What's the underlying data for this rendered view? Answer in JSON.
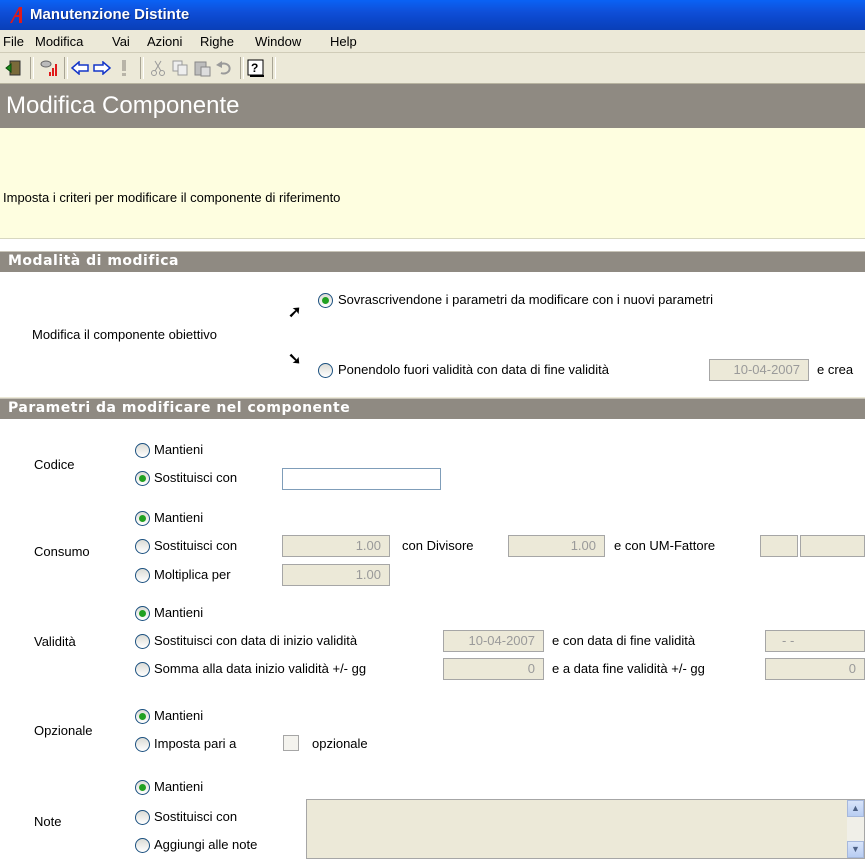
{
  "window": {
    "title": "Manutenzione Distinte"
  },
  "menu": [
    "File",
    "Modifica",
    "Vai",
    "Azioni",
    "Righe",
    "Window",
    "Help"
  ],
  "page": {
    "title": "Modifica Componente",
    "description": "Imposta i criteri per modificare il componente di riferimento"
  },
  "modalita": {
    "section_title": "Modalità di modifica",
    "label": "Modifica il componente obiettivo",
    "option_overwrite": "Sovrascrivendone i parametri da modificare con i nuovi parametri",
    "option_invalidate": "Ponendolo fuori validità con data di fine validità",
    "end_date": "10-04-2007",
    "trailing": "e crea"
  },
  "parametri": {
    "section_title": "Parametri da modificare nel componente",
    "codice": {
      "label": "Codice",
      "keep": "Mantieni",
      "replace": "Sostituisci con",
      "value": ""
    },
    "consumo": {
      "label": "Consumo",
      "keep": "Mantieni",
      "replace": "Sostituisci con",
      "multiply": "Moltiplica per",
      "replace_value": "1.00",
      "divisor_label": "con Divisore",
      "divisor_value": "1.00",
      "um_label": "e con UM-Fattore",
      "multiply_value": "1.00"
    },
    "validita": {
      "label": "Validità",
      "keep": "Mantieni",
      "replace": "Sostituisci con data di inizio validità",
      "start_date": "10-04-2007",
      "end_label": "e con data di fine validità",
      "end_date": "- -",
      "sum": "Somma alla data inizio validità +/- gg",
      "sum_start": "0",
      "sum_end_label": "e a data fine validità +/- gg",
      "sum_end": "0"
    },
    "opzionale": {
      "label": "Opzionale",
      "keep": "Mantieni",
      "set": "Imposta pari a",
      "suffix": "opzionale"
    },
    "note": {
      "label": "Note",
      "keep": "Mantieni",
      "replace": "Sostituisci con",
      "append": "Aggiungi alle note"
    }
  }
}
